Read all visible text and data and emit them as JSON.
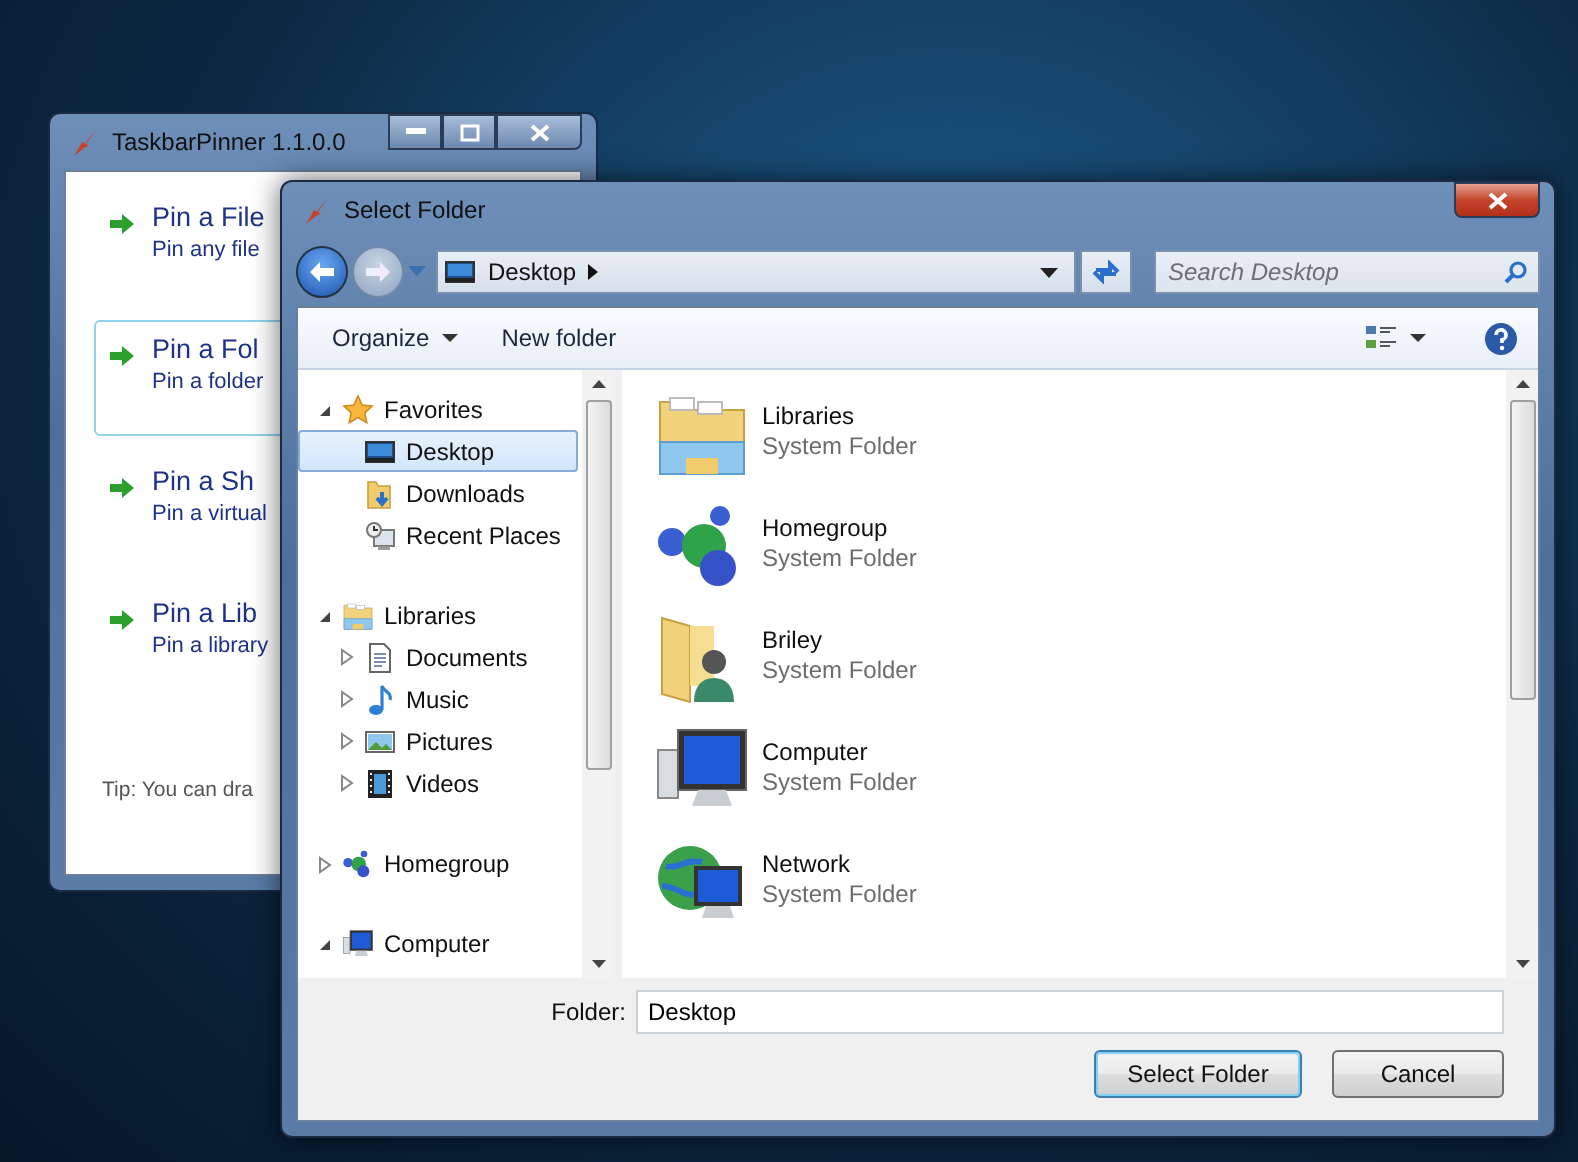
{
  "background_window": {
    "title": "TaskbarPinner 1.1.0.0",
    "items": [
      {
        "title": "Pin a File",
        "subtitle": "Pin any file",
        "selected": false
      },
      {
        "title": "Pin a Fol",
        "subtitle": "Pin a folder",
        "selected": true
      },
      {
        "title": "Pin a Sh",
        "subtitle": "Pin a virtual",
        "selected": false
      },
      {
        "title": "Pin a Lib",
        "subtitle": "Pin a library",
        "selected": false
      }
    ],
    "tip": "Tip: You can dra"
  },
  "dialog": {
    "title": "Select Folder",
    "address": "Desktop",
    "search": {
      "placeholder": "Search Desktop"
    },
    "toolbar": [
      "Organize",
      "New folder"
    ],
    "nav_tree": [
      {
        "label": "Favorites",
        "expanded": true,
        "selected": false,
        "children": [
          {
            "label": "Desktop",
            "selected": true
          },
          {
            "label": "Downloads",
            "selected": false
          },
          {
            "label": "Recent Places",
            "selected": false
          }
        ]
      },
      {
        "label": "Libraries",
        "expanded": true,
        "selected": false,
        "children": [
          {
            "label": "Documents",
            "expanded": false,
            "selected": false
          },
          {
            "label": "Music",
            "expanded": false,
            "selected": false
          },
          {
            "label": "Pictures",
            "expanded": false,
            "selected": false
          },
          {
            "label": "Videos",
            "expanded": false,
            "selected": false
          }
        ]
      },
      {
        "label": "Homegroup",
        "expanded": false,
        "selected": false
      },
      {
        "label": "Computer",
        "expanded": true,
        "selected": false
      }
    ],
    "items": [
      {
        "name": "Libraries",
        "type": "System Folder"
      },
      {
        "name": "Homegroup",
        "type": "System Folder"
      },
      {
        "name": "Briley",
        "type": "System Folder"
      },
      {
        "name": "Computer",
        "type": "System Folder"
      },
      {
        "name": "Network",
        "type": "System Folder"
      }
    ],
    "folder_label": "Folder:",
    "folder_value": "Desktop",
    "buttons": [
      {
        "label": "Select Folder",
        "default": true
      },
      {
        "label": "Cancel",
        "default": false
      }
    ]
  }
}
